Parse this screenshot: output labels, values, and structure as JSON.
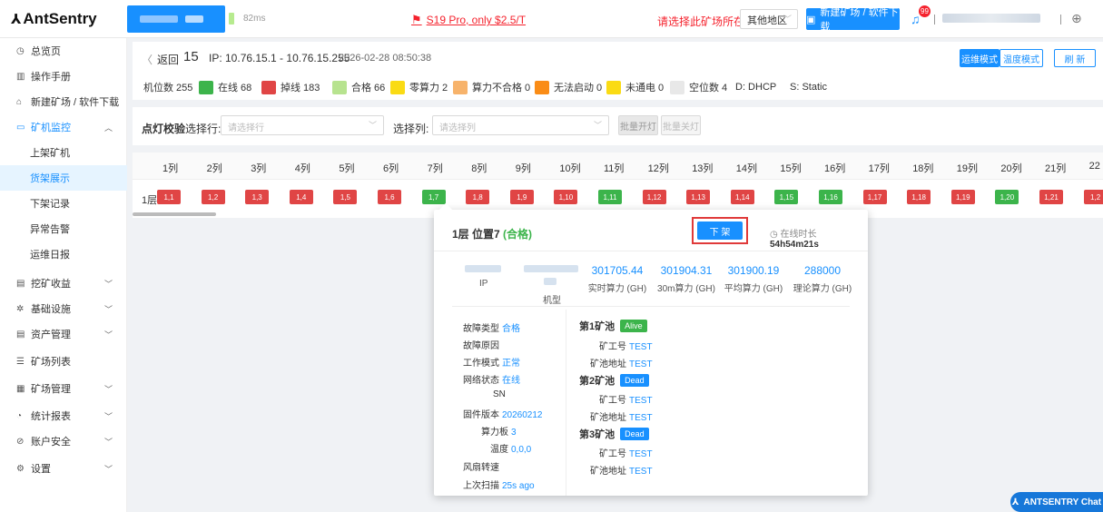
{
  "app": {
    "logo": "AntSentry",
    "ping": "82ms",
    "promo": "S19 Pro, only $2.5/T",
    "region_prompt": "请选择此矿场所在地区：",
    "region_value": "其他地区",
    "new_site_button": "新建矿场 / 软件下载",
    "notification_count": "99"
  },
  "sidebar": {
    "items": [
      {
        "label": "总览页",
        "icon": "clock-icon"
      },
      {
        "label": "操作手册",
        "icon": "book-icon"
      },
      {
        "label": "新建矿场 / 软件下载",
        "icon": "bank-icon"
      },
      {
        "label": "矿机监控",
        "icon": "monitor-icon"
      },
      {
        "label": "上架矿机"
      },
      {
        "label": "货架展示"
      },
      {
        "label": "下架记录"
      },
      {
        "label": "异常告警"
      },
      {
        "label": "运维日报"
      },
      {
        "label": "挖矿收益",
        "icon": "wallet-icon"
      },
      {
        "label": "基础设施",
        "icon": "gear-icon"
      },
      {
        "label": "资产管理",
        "icon": "folder-icon"
      },
      {
        "label": "矿场列表",
        "icon": "list-icon"
      },
      {
        "label": "矿场管理",
        "icon": "grid-icon"
      },
      {
        "label": "统计报表",
        "icon": "chart-icon"
      },
      {
        "label": "账户安全",
        "icon": "shield-icon"
      },
      {
        "label": "设置",
        "icon": "settings-icon"
      }
    ]
  },
  "header": {
    "back": "返回",
    "site_number": "15",
    "ip_range": "IP: 10.76.15.1 - 10.76.15.255",
    "timestamp": "2026-02-28 08:50:38",
    "mode_ops": "运维模式",
    "mode_temp": "温度模式",
    "refresh": "刷 新"
  },
  "legend": {
    "slots": "机位数 255",
    "items": [
      {
        "label": "在线 68",
        "color": "#3cb44b"
      },
      {
        "label": "掉线 183",
        "color": "#e04545"
      },
      {
        "label": "合格 66",
        "color": "#b7e38f"
      },
      {
        "label": "零算力 2",
        "color": "#fadb14"
      },
      {
        "label": "算力不合格 0",
        "color": "#f7b36b"
      },
      {
        "label": "无法启动 0",
        "color": "#fa8c16"
      },
      {
        "label": "未通电 0",
        "color": "#fadb14"
      },
      {
        "label": "空位数 4",
        "color": "#e8e8e8"
      }
    ],
    "dhcp": "D: DHCP",
    "static": "S: Static"
  },
  "light": {
    "title": "点灯校验",
    "row_label": "选择行:",
    "row_placeholder": "请选择行",
    "col_label": "选择列:",
    "col_placeholder": "请选择列",
    "batch_on": "批量开灯",
    "batch_off": "批量关灯"
  },
  "grid": {
    "columns": [
      "1列",
      "2列",
      "3列",
      "4列",
      "5列",
      "6列",
      "7列",
      "8列",
      "9列",
      "10列",
      "11列",
      "12列",
      "13列",
      "14列",
      "15列",
      "16列",
      "17列",
      "18列",
      "19列",
      "20列",
      "21列",
      "22"
    ],
    "row_label": "1层",
    "cells": [
      {
        "label": "1,1",
        "status": "red"
      },
      {
        "label": "1,2",
        "status": "red"
      },
      {
        "label": "1,3",
        "status": "red"
      },
      {
        "label": "1,4",
        "status": "red"
      },
      {
        "label": "1,5",
        "status": "red"
      },
      {
        "label": "1,6",
        "status": "red"
      },
      {
        "label": "1,7",
        "status": "green"
      },
      {
        "label": "1,8",
        "status": "red"
      },
      {
        "label": "1,9",
        "status": "red"
      },
      {
        "label": "1,10",
        "status": "red"
      },
      {
        "label": "1,11",
        "status": "green"
      },
      {
        "label": "1,12",
        "status": "red"
      },
      {
        "label": "1,13",
        "status": "red"
      },
      {
        "label": "1,14",
        "status": "red"
      },
      {
        "label": "1,15",
        "status": "green"
      },
      {
        "label": "1,16",
        "status": "green"
      },
      {
        "label": "1,17",
        "status": "red"
      },
      {
        "label": "1,18",
        "status": "red"
      },
      {
        "label": "1,19",
        "status": "red"
      },
      {
        "label": "1,20",
        "status": "green"
      },
      {
        "label": "1,21",
        "status": "red"
      },
      {
        "label": "1,2",
        "status": "red"
      }
    ]
  },
  "popup": {
    "title": "1层 位置7",
    "status": "(合格)",
    "remove_button": "下 架",
    "online_label": "在线时长",
    "online_value": "54h54m21s",
    "ip_label": "IP",
    "model_label": "机型",
    "stats": [
      {
        "value": "301705.44",
        "label": "实时算力 (GH)"
      },
      {
        "value": "301904.31",
        "label": "30m算力 (GH)"
      },
      {
        "value": "301900.19",
        "label": "平均算力 (GH)"
      },
      {
        "value": "288000",
        "label": "理论算力 (GH)"
      }
    ],
    "details": [
      {
        "key": "故障类型",
        "value": "合格"
      },
      {
        "key": "故障原因",
        "value": ""
      },
      {
        "key": "工作模式",
        "value": "正常"
      },
      {
        "key": "网络状态",
        "value": "在线"
      },
      {
        "key": "SN",
        "value": ""
      },
      {
        "key": "固件版本",
        "value": "20260212"
      },
      {
        "key": "算力板",
        "value": "3"
      },
      {
        "key": "温度",
        "value": "0,0,0"
      },
      {
        "key": "风扇转速",
        "value": ""
      },
      {
        "key": "上次扫描",
        "value": "25s ago"
      }
    ],
    "pools": [
      {
        "title": "第1矿池",
        "status": "Alive",
        "worker_label": "矿工号",
        "worker": "TEST",
        "addr_label": "矿池地址",
        "addr": "TEST"
      },
      {
        "title": "第2矿池",
        "status": "Dead",
        "worker_label": "矿工号",
        "worker": "TEST",
        "addr_label": "矿池地址",
        "addr": "TEST"
      },
      {
        "title": "第3矿池",
        "status": "Dead",
        "worker_label": "矿工号",
        "worker": "TEST",
        "addr_label": "矿池地址",
        "addr": "TEST"
      }
    ]
  },
  "chat": {
    "label": "ANTSENTRY Chat"
  }
}
